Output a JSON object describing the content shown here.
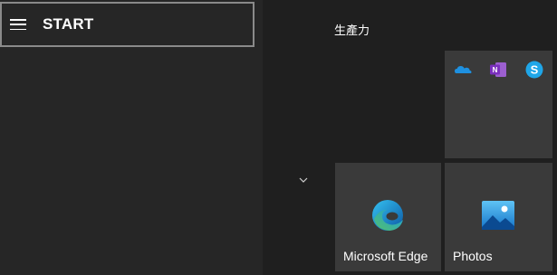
{
  "start_menu": {
    "header": {
      "menu_icon": "hamburger-menu-icon",
      "title": "START"
    },
    "group": {
      "title": "生產力",
      "collapse_icon": "chevron-down-icon"
    },
    "tiles": {
      "productivity_group": {
        "icons": [
          "onedrive-icon",
          "onenote-icon",
          "skype-icon"
        ]
      },
      "edge": {
        "label": "Microsoft Edge",
        "icon": "microsoft-edge-icon"
      },
      "photos": {
        "label": "Photos",
        "icon": "photos-icon"
      }
    }
  },
  "colors": {
    "left_pane_bg": "#262626",
    "right_pane_bg": "#1f1f1f",
    "tile_bg": "#3a3a3a",
    "header_border": "#8a8a8a",
    "text": "#ffffff"
  }
}
